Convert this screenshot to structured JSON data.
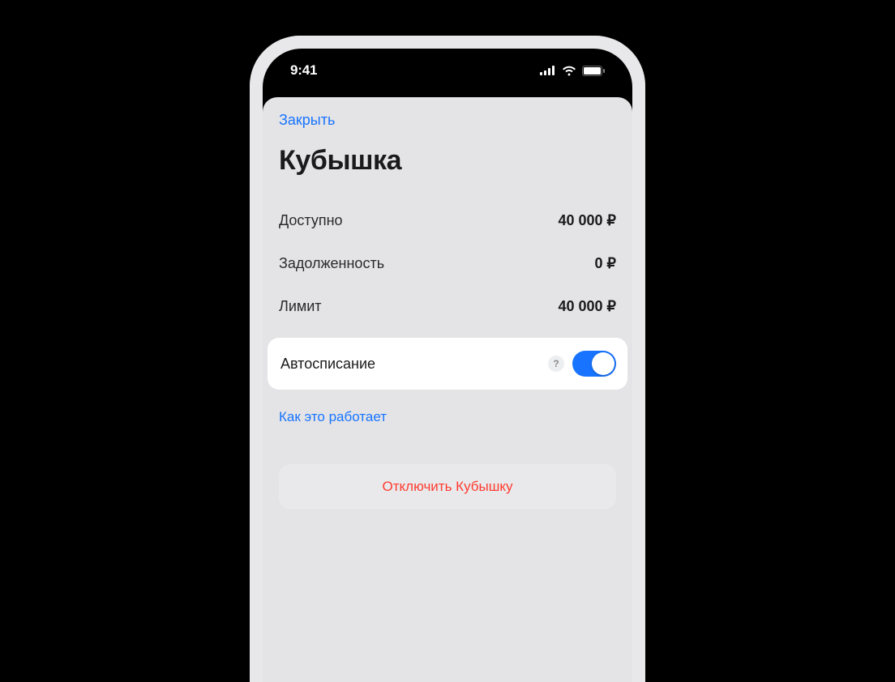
{
  "status": {
    "time": "9:41"
  },
  "sheet": {
    "close_label": "Закрыть",
    "title": "Кубышка",
    "stats": {
      "available_label": "Доступно",
      "available_value": "40 000 ₽",
      "debt_label": "Задолженность",
      "debt_value": "0 ₽",
      "limit_label": "Лимит",
      "limit_value": "40 000 ₽"
    },
    "autopay": {
      "label": "Автосписание",
      "help_glyph": "?",
      "enabled": true
    },
    "how_it_works_label": "Как это работает",
    "disable_label": "Отключить Кубышку"
  },
  "colors": {
    "accent": "#1874ff",
    "destructive": "#ff3b30"
  }
}
